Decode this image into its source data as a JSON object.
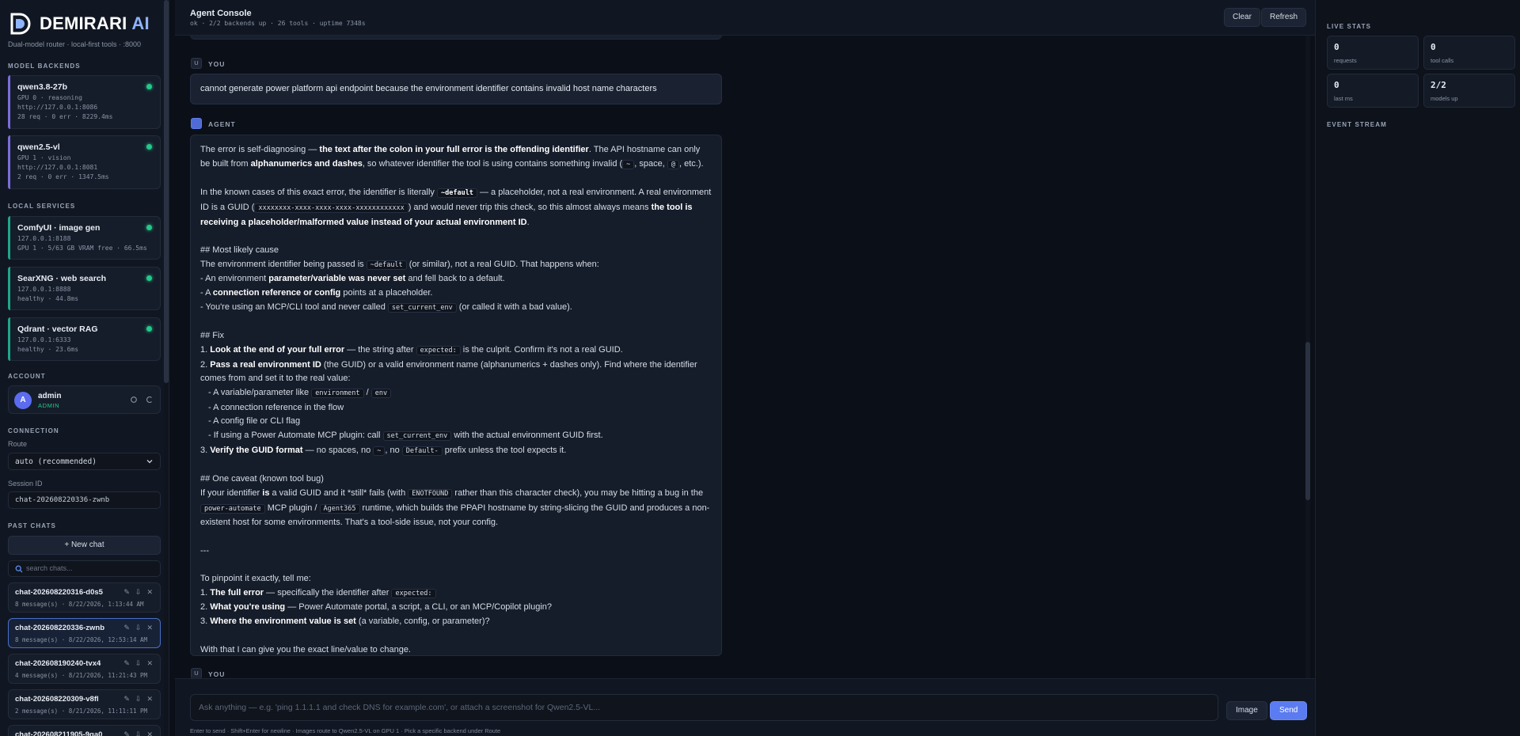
{
  "brand": {
    "name": "DEMIRARI",
    "suffix": "AI",
    "tagline": "Dual-model router · local-first tools · :8000"
  },
  "sidebar": {
    "model_backends_title": "MODEL BACKENDS",
    "backends": [
      {
        "name": "qwen3.8-27b",
        "line1": "GPU 0 · reasoning",
        "line2": "http://127.0.0.1:8086",
        "line3": "28 req · 0 err · 8229.4ms"
      },
      {
        "name": "qwen2.5-vl",
        "line1": "GPU 1 · vision",
        "line2": "http://127.0.0.1:8081",
        "line3": "2 req · 0 err · 1347.5ms"
      }
    ],
    "local_services_title": "LOCAL SERVICES",
    "services": [
      {
        "name": "ComfyUI · image gen",
        "line1": "127.0.0.1:8188",
        "line2": "GPU 1 · 5/63 GB VRAM free · 66.5ms"
      },
      {
        "name": "SearXNG · web search",
        "line1": "127.0.0.1:8888",
        "line2": "healthy · 44.8ms"
      },
      {
        "name": "Qdrant · vector RAG",
        "line1": "127.0.0.1:6333",
        "line2": "healthy · 23.6ms"
      }
    ],
    "account_title": "ACCOUNT",
    "account": {
      "initial": "A",
      "name": "admin",
      "role": "ADMIN"
    },
    "connection_title": "CONNECTION",
    "route_label": "Route",
    "route_value": "auto (recommended)",
    "session_label": "Session ID",
    "session_value": "chat-202608220336-zwnb",
    "past_chats_title": "PAST CHATS",
    "new_chat_label": "+ New chat",
    "search_placeholder": "search chats...",
    "chats": [
      {
        "name": "chat-202608220316-d0s5",
        "meta": "8 message(s) · 8/22/2026, 1:13:44 AM"
      },
      {
        "name": "chat-202608220336-zwnb",
        "meta": "8 message(s) · 8/22/2026, 12:53:14 AM"
      },
      {
        "name": "chat-202608190240-tvx4",
        "meta": "4 message(s) · 8/21/2026, 11:21:43 PM"
      },
      {
        "name": "chat-202608220309-v8fl",
        "meta": "2 message(s) · 8/21/2026, 11:11:11 PM"
      },
      {
        "name": "chat-202608211905-9qa0",
        "meta": ""
      }
    ]
  },
  "topbar": {
    "title": "Agent Console",
    "subtitle": "ok · 2/2 backends up · 26 tools · uptime 7348s",
    "clear_label": "Clear",
    "refresh_label": "Refresh"
  },
  "chat": {
    "user_role": "YOU",
    "agent_role": "AGENT",
    "user_initial": "U",
    "user_message": "cannot generate power platform api endpoint because the environment identifier contains invalid host name characters",
    "agent": {
      "p1_a": "The error is self-diagnosing — ",
      "p1_b": "the text after the colon in your full error is the offending identifier",
      "p1_c": ". The API hostname can only be built from ",
      "p1_d": "alphanumerics and dashes",
      "p1_e": ", so whatever identifier the tool is using contains something invalid (",
      "p1_f": "~",
      "p1_g": ", space, ",
      "p1_h": "@",
      "p1_i": ", etc.).",
      "p2_a": "In the known cases of this exact error, the identifier is literally ",
      "p2_b": "~default",
      "p2_c": " — a placeholder, not a real environment. A real environment ID is a GUID (",
      "p2_d": "xxxxxxxx-xxxx-xxxx-xxxx-xxxxxxxxxxxx",
      "p2_e": ") and would never trip this check, so this almost always means ",
      "p2_f": "the tool is receiving a placeholder/malformed value instead of your actual environment ID",
      "p2_g": ".",
      "h1": "## Most likely cause",
      "c1_a": "The environment identifier being passed is ",
      "c1_b": "~default",
      "c1_c": " (or similar), not a real GUID. That happens when:",
      "c2_a": "- An environment ",
      "c2_b": "parameter/variable was never set",
      "c2_c": " and fell back to a default.",
      "c3_a": "- A ",
      "c3_b": "connection reference or config",
      "c3_c": " points at a placeholder.",
      "c4_a": "- You're using an MCP/CLI tool and never called ",
      "c4_b": "set_current_env",
      "c4_c": " (or called it with a bad value).",
      "h2": "## Fix",
      "f1_a": "1. ",
      "f1_b": "Look at the end of your full error",
      "f1_c": " — the string after ",
      "f1_d": "expected:",
      "f1_e": " is the culprit. Confirm it's not a real GUID.",
      "f2_a": "2. ",
      "f2_b": "Pass a real environment ID",
      "f2_c": " (the GUID) or a valid environment name (alphanumerics + dashes only). Find where the identifier comes from and set it to the real value:",
      "f3_a": "- A variable/parameter like ",
      "f3_b": "environment",
      "f3_c": " / ",
      "f3_d": "env",
      "f4": "- A connection reference in the flow",
      "f5": "- A config file or CLI flag",
      "f6_a": "- If using a Power Automate MCP plugin: call ",
      "f6_b": "set_current_env",
      "f6_c": " with the actual environment GUID first.",
      "f7_a": "3. ",
      "f7_b": "Verify the GUID format",
      "f7_c": " — no spaces, no ",
      "f7_d": "~",
      "f7_e": ", no ",
      "f7_f": "Default-",
      "f7_g": " prefix unless the tool expects it.",
      "h3": "## One caveat (known tool bug)",
      "k1_a": "If your identifier ",
      "k1_b": "is",
      "k1_c": " a valid GUID and it *still* fails (with ",
      "k1_d": "ENOTFOUND",
      "k1_e": " rather than this character check), you may be hitting a bug in the ",
      "k1_f": "power-automate",
      "k1_g": " MCP plugin / ",
      "k1_h": "Agent365",
      "k1_i": " runtime, which builds the PPAPI hostname by string-slicing the GUID and produces a non-existent host for some environments. That's a tool-side issue, not your config.",
      "sep": "---",
      "t0": "To pinpoint it exactly, tell me:",
      "t1_a": "1. ",
      "t1_b": "The full error",
      "t1_c": " — specifically the identifier after ",
      "t1_d": "expected:",
      "t2_a": "2. ",
      "t2_b": "What you're using",
      "t2_c": " — Power Automate portal, a script, a CLI, or an MCP/Copilot plugin?",
      "t3_a": "3. ",
      "t3_b": "Where the environment value is set",
      "t3_c": " (a variable, config, or parameter)?",
      "end": "With that I can give you the exact line/value to change."
    }
  },
  "composer": {
    "placeholder": "Ask anything — e.g. 'ping 1.1.1.1 and check DNS for example.com', or attach a screenshot for Qwen2.5-VL...",
    "image_label": "Image",
    "send_label": "Send",
    "hint": "Enter to send · Shift+Enter for newline · Images route to Qwen2.5-VL on GPU 1 · Pick a specific backend under Route"
  },
  "right_panel": {
    "live_stats_title": "LIVE STATS",
    "stats": [
      {
        "value": "0",
        "label": "requests"
      },
      {
        "value": "0",
        "label": "tool calls"
      },
      {
        "value": "0",
        "label": "last ms"
      },
      {
        "value": "2/2",
        "label": "models up"
      }
    ],
    "event_stream_title": "EVENT STREAM"
  },
  "colors": {
    "accent": "#5b7bf0",
    "healthy": "#22c98a",
    "backend_bar": "#7b6cd9",
    "service_bar": "#1fa58a"
  }
}
